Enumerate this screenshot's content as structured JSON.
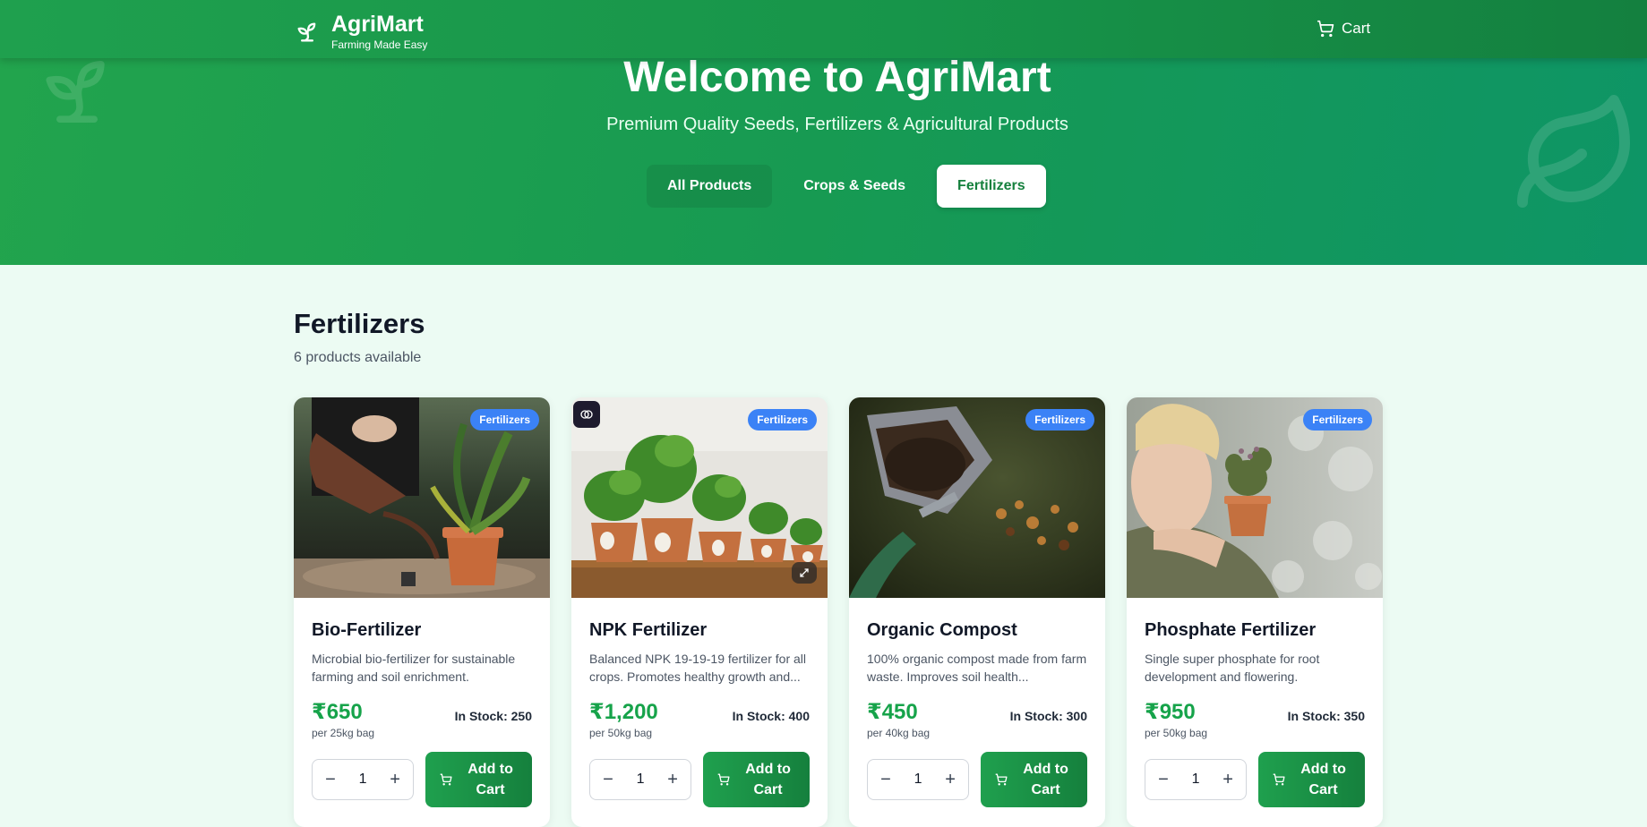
{
  "nav": {
    "brand_name": "AgriMart",
    "brand_tagline": "Farming Made Easy",
    "cart_label": "Cart"
  },
  "hero": {
    "title": "Welcome to AgriMart",
    "subtitle": "Premium Quality Seeds, Fertilizers & Agricultural Products",
    "tabs": [
      {
        "label": "All Products",
        "active": false
      },
      {
        "label": "Crops & Seeds",
        "active": false
      },
      {
        "label": "Fertilizers",
        "active": true
      }
    ]
  },
  "section": {
    "title": "Fertilizers",
    "count_text": "6 products available"
  },
  "products": [
    {
      "name": "Bio-Fertilizer",
      "badge": "Fertilizers",
      "description": "Microbial bio-fertilizer for sustainable farming and soil enrichment.",
      "price": "₹650",
      "unit": "per 25kg bag",
      "stock": "In Stock: 250",
      "quantity": "1",
      "add_label": "Add to Cart"
    },
    {
      "name": "NPK Fertilizer",
      "badge": "Fertilizers",
      "description": "Balanced NPK 19-19-19 fertilizer for all crops. Promotes healthy growth and...",
      "price": "₹1,200",
      "unit": "per 50kg bag",
      "stock": "In Stock: 400",
      "quantity": "1",
      "add_label": "Add to Cart"
    },
    {
      "name": "Organic Compost",
      "badge": "Fertilizers",
      "description": "100% organic compost made from farm waste. Improves soil health...",
      "price": "₹450",
      "unit": "per 40kg bag",
      "stock": "In Stock: 300",
      "quantity": "1",
      "add_label": "Add to Cart"
    },
    {
      "name": "Phosphate Fertilizer",
      "badge": "Fertilizers",
      "description": "Single super phosphate for root development and flowering.",
      "price": "₹950",
      "unit": "per 50kg bag",
      "stock": "In Stock: 350",
      "quantity": "1",
      "add_label": "Add to Cart"
    }
  ],
  "colors": {
    "brand_green": "#16a34a",
    "badge_blue": "#3b82f6",
    "page_background": "#ecfbf3"
  }
}
